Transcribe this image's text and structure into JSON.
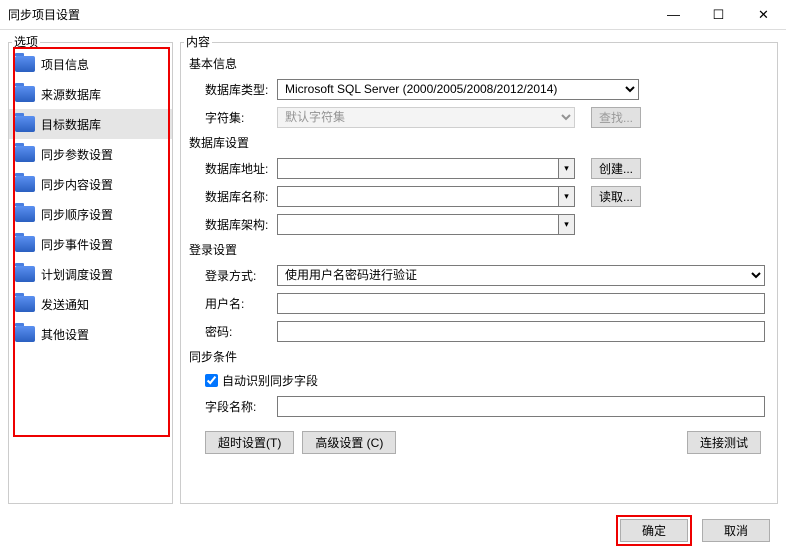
{
  "window": {
    "title": "同步项目设置"
  },
  "panels": {
    "left": "选项",
    "right": "内容"
  },
  "sidebar": {
    "items": [
      {
        "label": "项目信息"
      },
      {
        "label": "来源数据库"
      },
      {
        "label": "目标数据库"
      },
      {
        "label": "同步参数设置"
      },
      {
        "label": "同步内容设置"
      },
      {
        "label": "同步顺序设置"
      },
      {
        "label": "同步事件设置"
      },
      {
        "label": "计划调度设置"
      },
      {
        "label": "发送通知"
      },
      {
        "label": "其他设置"
      }
    ],
    "selected_index": 2
  },
  "sections": {
    "basic": "基本信息",
    "db": "数据库设置",
    "login": "登录设置",
    "sync": "同步条件"
  },
  "labels": {
    "db_type": "数据库类型:",
    "charset": "字符集:",
    "db_addr": "数据库地址:",
    "db_name": "数据库名称:",
    "db_schema": "数据库架构:",
    "login_mode": "登录方式:",
    "username": "用户名:",
    "password": "密码:",
    "auto_detect": "自动识别同步字段",
    "field_name": "字段名称:"
  },
  "values": {
    "db_type": "Microsoft SQL Server (2000/2005/2008/2012/2014)",
    "charset": "默认字符集",
    "db_addr": "",
    "db_name": "",
    "db_schema": "",
    "login_mode": "使用用户名密码进行验证",
    "username": "",
    "password": "",
    "field_name": ""
  },
  "buttons": {
    "find": "查找...",
    "create": "创建...",
    "read": "读取...",
    "timeout": "超时设置(T)",
    "advanced": "高级设置 (C)",
    "test": "连接测试",
    "ok": "确定",
    "cancel": "取消"
  },
  "auto_detect_checked": true
}
